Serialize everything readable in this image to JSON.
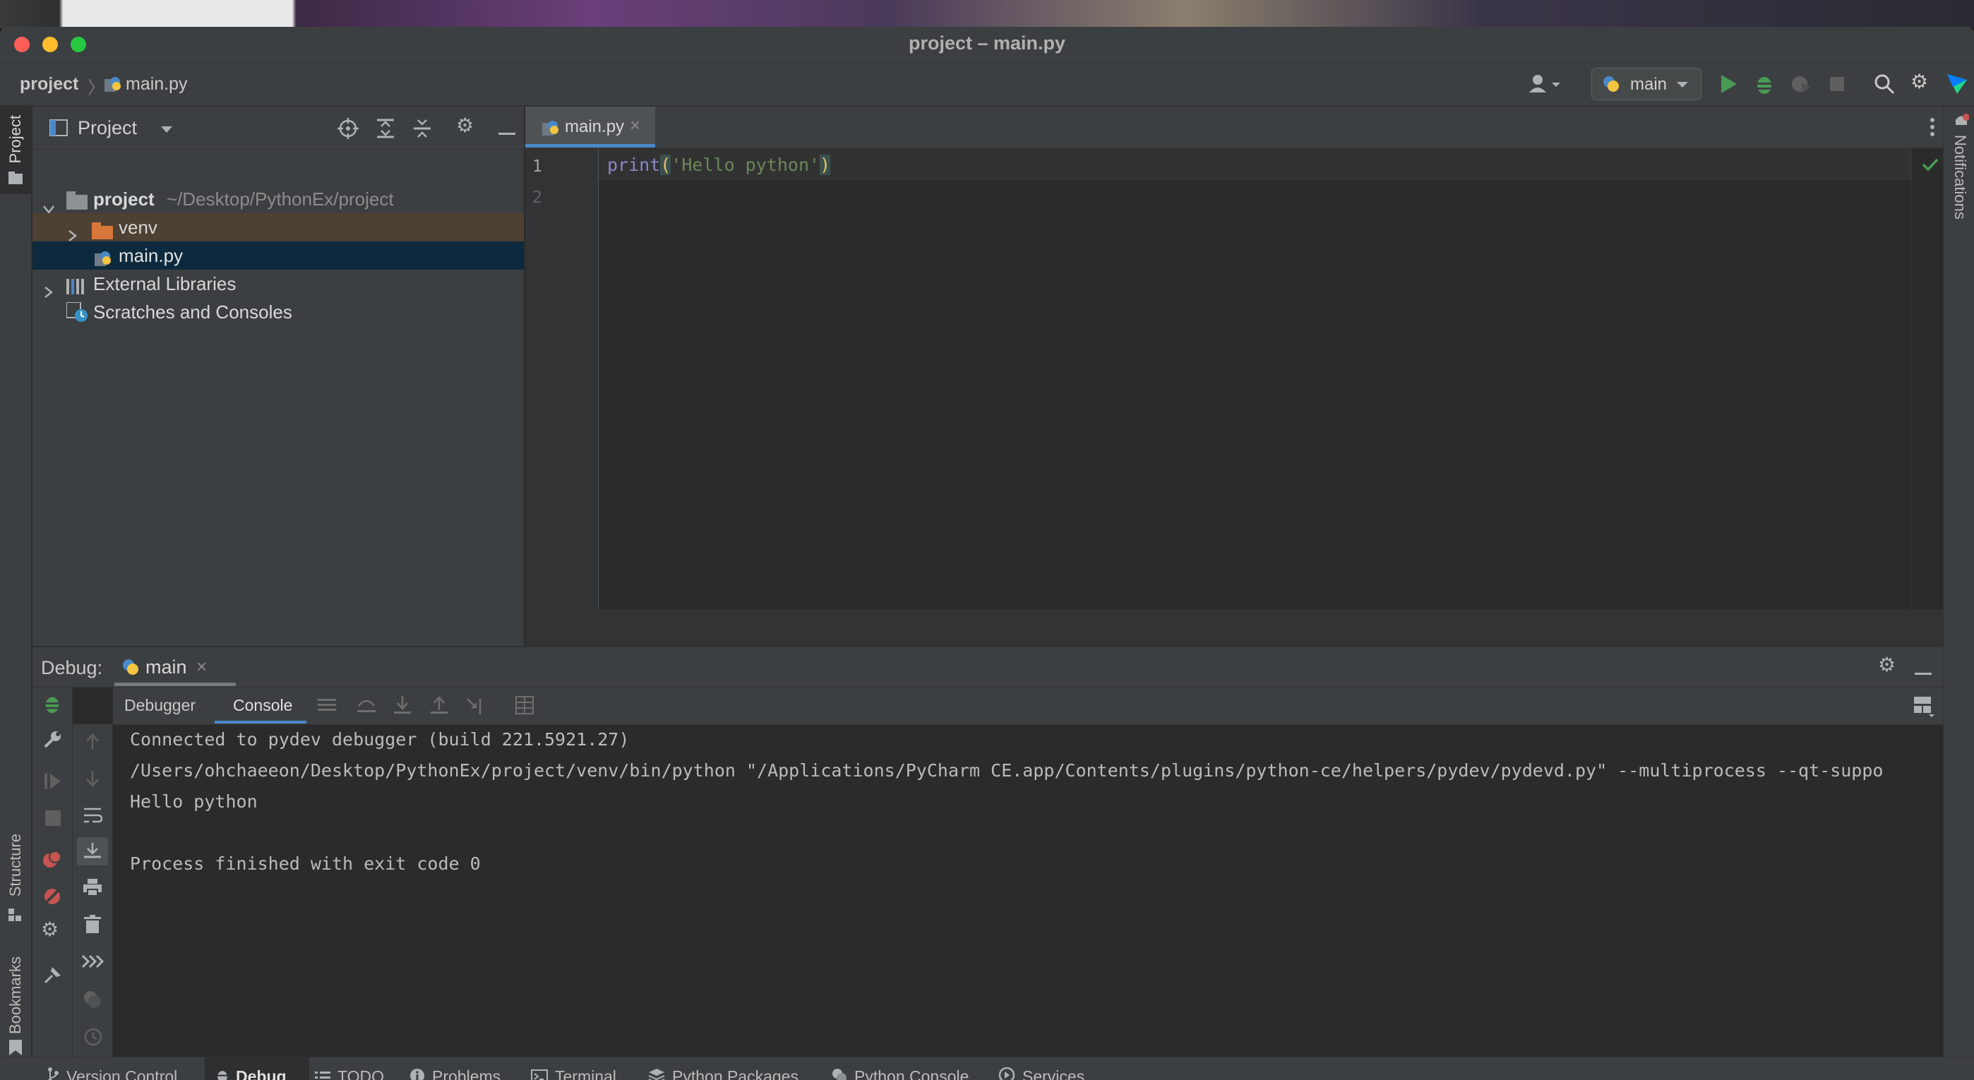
{
  "window": {
    "title": "project – main.py"
  },
  "navbar": {
    "project": "project",
    "file": "main.py",
    "run_config": "main"
  },
  "left_stripe": {
    "project": "Project",
    "structure": "Structure",
    "bookmarks": "Bookmarks"
  },
  "right_stripe": {
    "notifications": "Notifications"
  },
  "project_panel": {
    "title": "Project",
    "tree": {
      "root_name": "project",
      "root_path": "~/Desktop/PythonEx/project",
      "venv": "venv",
      "main": "main.py",
      "external": "External Libraries",
      "scratches": "Scratches and Consoles"
    }
  },
  "editor": {
    "tab": "main.py",
    "line_numbers": [
      "1",
      "2"
    ],
    "code": {
      "func": "print",
      "open": "(",
      "string": "'Hello python'",
      "close": ")"
    }
  },
  "debug": {
    "label": "Debug:",
    "session": "main",
    "tab_debugger": "Debugger",
    "tab_console": "Console",
    "console_lines": [
      "Connected to pydev debugger (build 221.5921.27)",
      "/Users/ohchaeeon/Desktop/PythonEx/project/venv/bin/python \"/Applications/PyCharm CE.app/Contents/plugins/python-ce/helpers/pydev/pydevd.py\" --multiprocess --qt-suppo",
      "Hello python",
      "",
      "Process finished with exit code 0"
    ]
  },
  "bottom_tabs": {
    "version_control": "Version Control",
    "debug": "Debug",
    "todo": "TODO",
    "problems": "Problems",
    "terminal": "Terminal",
    "python_packages": "Python Packages",
    "python_console": "Python Console",
    "services": "Services"
  },
  "colors": {
    "accent_blue": "#4a88c7",
    "run_green": "#499c54",
    "keyword": "#8888c6",
    "string": "#6a8759",
    "selection": "#0d293e",
    "folder_highlight": "#4d4133",
    "breakpoint_red": "#c75450"
  },
  "icons": [
    "python-file-icon",
    "folder-icon",
    "library-icon",
    "scratch-icon",
    "run-icon",
    "debug-bug-icon",
    "stop-icon",
    "search-icon",
    "gear-icon",
    "close-icon",
    "checkmark-icon",
    "chevron-down-icon",
    "user-icon"
  ]
}
